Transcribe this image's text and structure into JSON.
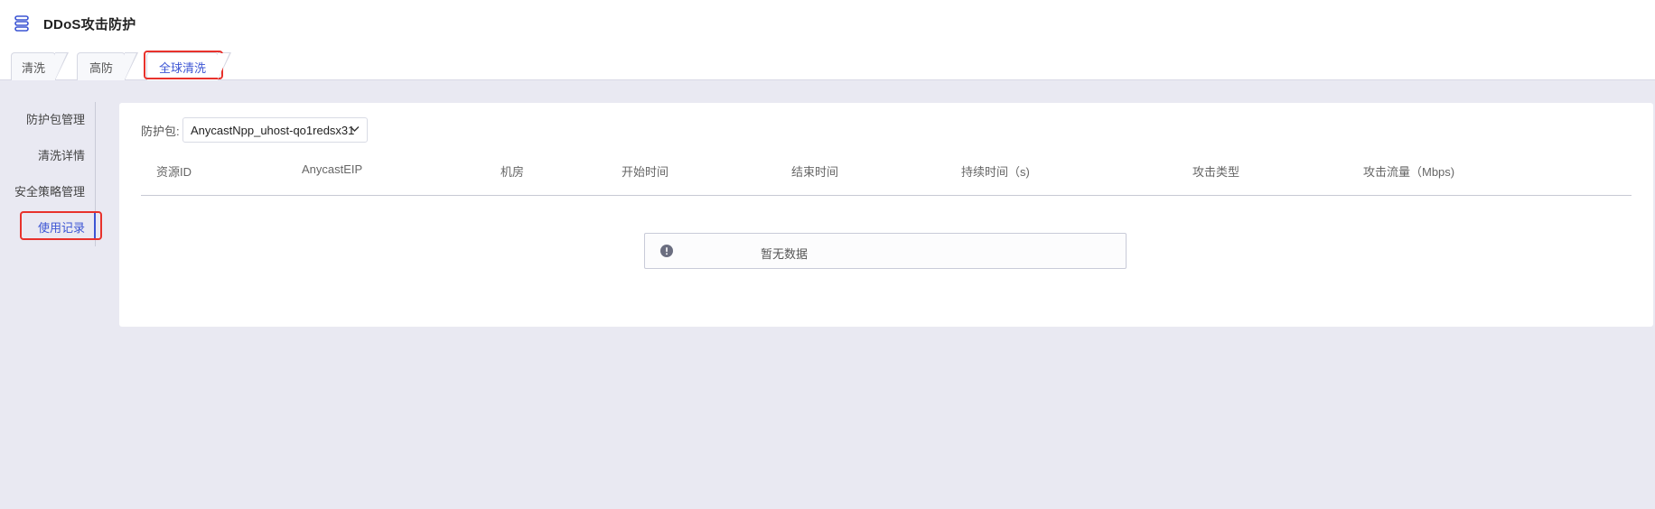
{
  "app": {
    "title": "DDoS攻击防护",
    "menu_icon": "server-stack-icon"
  },
  "tabs": [
    {
      "label": "清洗",
      "active": false
    },
    {
      "label": "高防",
      "active": false
    },
    {
      "label": "全球清洗",
      "active": true
    }
  ],
  "sidebar": {
    "items": [
      {
        "label": "防护包管理",
        "active": false
      },
      {
        "label": "清洗详情",
        "active": false
      },
      {
        "label": "安全策略管理",
        "active": false
      },
      {
        "label": "使用记录",
        "active": true
      }
    ]
  },
  "filter": {
    "label": "防护包:",
    "selected": "AnycastNpp_uhost-qo1redsx31",
    "chevron_icon": "chevron-down-icon"
  },
  "table": {
    "columns": [
      "资源ID",
      "AnycastEIP",
      "机房",
      "开始时间",
      "结束时间",
      "持续时间（s)",
      "攻击类型",
      "攻击流量（Mbps)"
    ],
    "rows": []
  },
  "empty_state": {
    "icon": "info-circle-icon",
    "text": "暂无数据"
  },
  "colors": {
    "accent": "#3c55d4",
    "highlight": "#e8322c",
    "background": "#e9e9f2"
  }
}
